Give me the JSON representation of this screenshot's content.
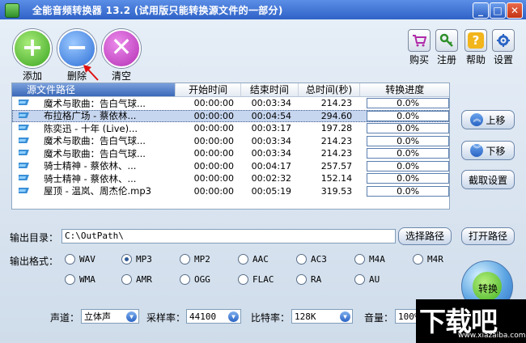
{
  "window": {
    "title": "全能音频转换器 13.2 (试用版只能转换源文件的一部分)",
    "minimize": "_",
    "maximize": "□",
    "close": "✕"
  },
  "toolbar": {
    "add_label": "添加",
    "delete_label": "删除",
    "clear_label": "清空",
    "buy_label": "购买",
    "register_label": "注册",
    "help_label": "帮助",
    "settings_label": "设置"
  },
  "list": {
    "headers": {
      "source_path": "源文件路径",
      "start_time": "开始时间",
      "end_time": "结束时间",
      "total_time": "总时间(秒)",
      "progress": "转换进度"
    },
    "rows": [
      {
        "name": "魔术与歌曲：告白气球...",
        "start": "00:00:00",
        "end": "00:03:34",
        "total": "214.23",
        "progress": "0.0%"
      },
      {
        "name": "布拉格广场 - 蔡依林...",
        "start": "00:00:00",
        "end": "00:04:54",
        "total": "294.60",
        "progress": "0.0%"
      },
      {
        "name": "陈奕迅 - 十年 (Live)...",
        "start": "00:00:00",
        "end": "00:03:17",
        "total": "197.28",
        "progress": "0.0%"
      },
      {
        "name": "魔术与歌曲：告白气球...",
        "start": "00:00:00",
        "end": "00:03:34",
        "total": "214.23",
        "progress": "0.0%"
      },
      {
        "name": "魔术与歌曲：告白气球...",
        "start": "00:00:00",
        "end": "00:03:34",
        "total": "214.23",
        "progress": "0.0%"
      },
      {
        "name": "骑士精神 - 蔡依林、...",
        "start": "00:00:00",
        "end": "00:04:17",
        "total": "257.57",
        "progress": "0.0%"
      },
      {
        "name": "骑士精神 - 蔡依林、...",
        "start": "00:00:00",
        "end": "00:02:32",
        "total": "152.14",
        "progress": "0.0%"
      },
      {
        "name": "屋顶 - 温岚、周杰伦.mp3",
        "start": "00:00:00",
        "end": "00:05:19",
        "total": "319.53",
        "progress": "0.0%"
      }
    ]
  },
  "side": {
    "up_label": "上移",
    "down_label": "下移",
    "trim_label": "截取设置",
    "open_path_label": "打开路径"
  },
  "output": {
    "dir_label": "输出目录：",
    "dir_value": "C:\\OutPath\\",
    "choose_path_label": "选择路径",
    "format_label": "输出格式：",
    "formats": [
      "WAV",
      "MP3",
      "MP2",
      "AAC",
      "AC3",
      "M4A",
      "M4R",
      "WMA",
      "AMR",
      "OGG",
      "FLAC",
      "RA",
      "AU"
    ],
    "selected_format": "MP3"
  },
  "params": {
    "channel_label": "声道：",
    "channel_value": "立体声",
    "samplerate_label": "采样率：",
    "samplerate_value": "44100",
    "bitrate_label": "比特率：",
    "bitrate_value": "128K",
    "volume_label": "音量：",
    "volume_value": "100%"
  },
  "convert_label": "转换",
  "watermark": {
    "text": "下载吧",
    "url": "www.xiazaiba.com"
  },
  "colors": {
    "title_bar": "#2f62c7",
    "selected_row": "#c7d6ef",
    "add_green": "#3aa520",
    "delete_blue": "#2b6ed6",
    "clear_purple": "#b32fb4"
  }
}
